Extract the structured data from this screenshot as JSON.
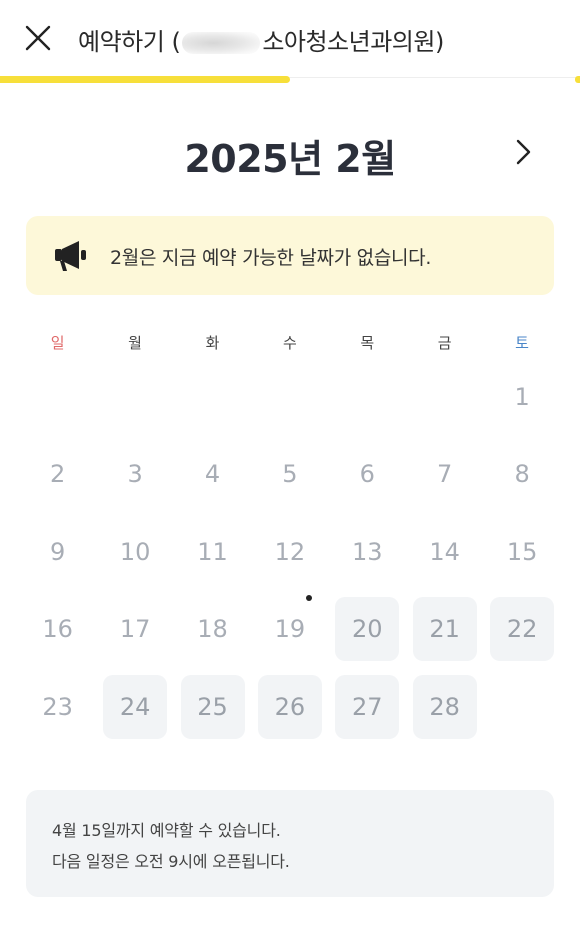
{
  "header": {
    "close_icon": "close-icon",
    "title_prefix": "예약하기 (",
    "title_suffix": "소아청소년과의원)"
  },
  "progress": {
    "fraction": 0.5
  },
  "calendar": {
    "month_title": "2025년 2월",
    "next_icon": "chevron-right-icon",
    "weekdays": [
      "일",
      "월",
      "화",
      "수",
      "목",
      "금",
      "토"
    ],
    "weeks": [
      [
        null,
        null,
        null,
        null,
        null,
        null,
        {
          "day": "1",
          "available": false
        }
      ],
      [
        {
          "day": "2",
          "available": false
        },
        {
          "day": "3",
          "available": false
        },
        {
          "day": "4",
          "available": false
        },
        {
          "day": "5",
          "available": false
        },
        {
          "day": "6",
          "available": false
        },
        {
          "day": "7",
          "available": false
        },
        {
          "day": "8",
          "available": false
        }
      ],
      [
        {
          "day": "9",
          "available": false
        },
        {
          "day": "10",
          "available": false
        },
        {
          "day": "11",
          "available": false
        },
        {
          "day": "12",
          "available": false
        },
        {
          "day": "13",
          "available": false
        },
        {
          "day": "14",
          "available": false
        },
        {
          "day": "15",
          "available": false
        }
      ],
      [
        {
          "day": "16",
          "available": false
        },
        {
          "day": "17",
          "available": false
        },
        {
          "day": "18",
          "available": false
        },
        {
          "day": "19",
          "available": false,
          "today": true
        },
        {
          "day": "20",
          "available": true
        },
        {
          "day": "21",
          "available": true
        },
        {
          "day": "22",
          "available": true
        }
      ],
      [
        {
          "day": "23",
          "available": false
        },
        {
          "day": "24",
          "available": true
        },
        {
          "day": "25",
          "available": true
        },
        {
          "day": "26",
          "available": true
        },
        {
          "day": "27",
          "available": true
        },
        {
          "day": "28",
          "available": true
        },
        null
      ]
    ]
  },
  "notice": {
    "icon": "megaphone-icon",
    "text": "2월은 지금 예약 가능한 날짜가 없습니다."
  },
  "info": {
    "line1": "4월 15일까지 예약할 수 있습니다.",
    "line2": "다음 일정은 오전 9시에 오픈됩니다."
  },
  "colors": {
    "accent": "#f7df3a",
    "notice_bg": "#fdf8d9",
    "sunday": "#e06a6a",
    "saturday": "#4a86c8",
    "cell_bg": "#f2f4f6"
  }
}
